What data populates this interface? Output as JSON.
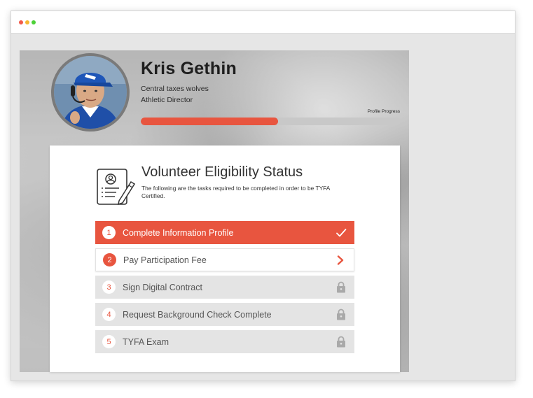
{
  "profile": {
    "name": "Kris Gethin",
    "team": "Central taxes wolves",
    "role": "Athletic Director",
    "progress_label": "Profile Progress",
    "progress_fraction": 0.53
  },
  "card": {
    "title": "Volunteer Eligibility Status",
    "description": "The following are the tasks required to be completed in order to be TYFA Certified."
  },
  "tasks": [
    {
      "number": "1",
      "label": "Complete Information Profile",
      "state": "done",
      "icon": "check-icon"
    },
    {
      "number": "2",
      "label": "Pay Participation Fee",
      "state": "current",
      "icon": "chevron-right-icon"
    },
    {
      "number": "3",
      "label": "Sign Digital Contract",
      "state": "locked",
      "icon": "lock-icon"
    },
    {
      "number": "4",
      "label": "Request Background Check Complete",
      "state": "locked",
      "icon": "lock-icon"
    },
    {
      "number": "5",
      "label": "TYFA Exam",
      "state": "locked",
      "icon": "lock-icon"
    }
  ],
  "colors": {
    "accent": "#e8553f",
    "locked_row": "#e4e4e4",
    "lock_icon": "#a9a9a9"
  }
}
